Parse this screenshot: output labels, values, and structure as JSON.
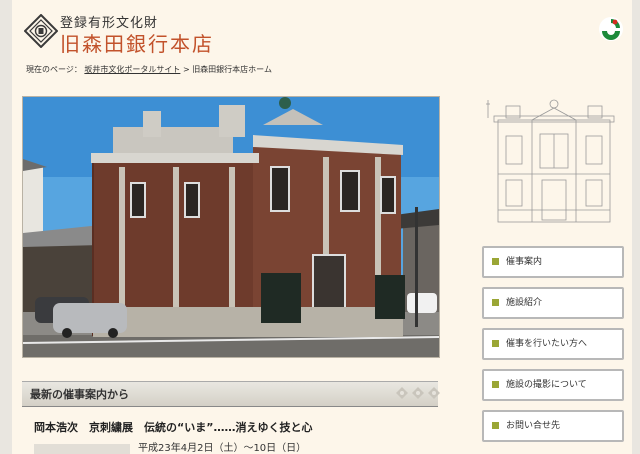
{
  "header": {
    "subtitle": "登録有形文化財",
    "title": "旧森田銀行本店"
  },
  "breadcrumb": {
    "current_label": "現在のページ：",
    "portal_link": "坂井市文化ポータルサイト",
    "separator": ">",
    "home": "旧森田銀行本店ホーム"
  },
  "nav": {
    "items": [
      {
        "label": "催事案内"
      },
      {
        "label": "施設紹介"
      },
      {
        "label": "催事を行いたい方へ"
      },
      {
        "label": "施設の撮影について"
      },
      {
        "label": "お問い合せ先"
      }
    ]
  },
  "section": {
    "title": "最新の催事案内から"
  },
  "event": {
    "title": "岡本浩次　京刺繍展　伝統の“いま”……消えゆく技と心",
    "date": "平成23年4月2日（土）〜10日（日）"
  },
  "colors": {
    "title": "#c2522b",
    "nav_square": "#9aa635",
    "page_bg": "#fdf6ea"
  }
}
